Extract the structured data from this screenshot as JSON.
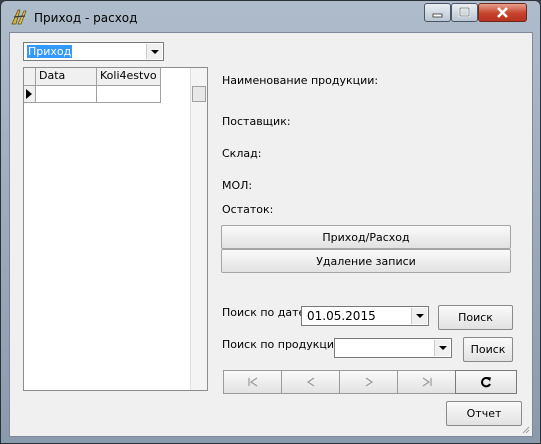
{
  "window": {
    "title": "Приход - расход"
  },
  "type_select": {
    "value": "Приход"
  },
  "grid": {
    "columns": [
      "Data",
      "Koli4estvo"
    ]
  },
  "labels": {
    "product": "Наименование продукции:",
    "supplier": "Поставщик:",
    "warehouse": "Склад:",
    "mol": "МОЛ:",
    "remainder": "Остаток:"
  },
  "buttons": {
    "income_expense": "Приход/Расход",
    "delete_record": "Удаление записи",
    "search_date": "Поиск",
    "search_product": "Поиск",
    "report": "Отчет"
  },
  "search": {
    "date_label": "Поиск по дате",
    "date_value": "01.05.2015",
    "product_label": "Поиск по продукции:",
    "product_value": ""
  },
  "navigator": [
    "first-icon",
    "prior-icon",
    "next-icon",
    "last-icon",
    "refresh-icon"
  ]
}
